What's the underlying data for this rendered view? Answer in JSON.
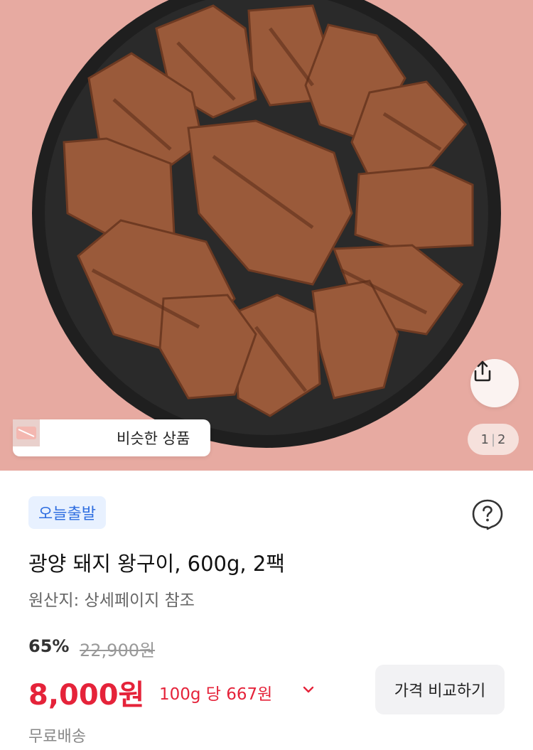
{
  "similar_products": {
    "label": "비슷한 상품"
  },
  "pager": {
    "current": "1",
    "separator": "|",
    "total": "2"
  },
  "product": {
    "badge": "오늘출발",
    "title": "광양 돼지 왕구이, 600g, 2팩",
    "origin": "원산지: 상세페이지 참조",
    "discount": "65%",
    "original_price": "22,900원",
    "price": "8,000원",
    "unit_price": "100g 당 667원",
    "compare_button": "가격 비교하기",
    "shipping": "무료배송"
  },
  "colors": {
    "hero_background": "#e7aaa1",
    "price_red": "#e5233a",
    "badge_blue": "#2f6ee0"
  },
  "icons": [
    "share-icon",
    "help-chat-icon",
    "chevron-down-icon"
  ]
}
